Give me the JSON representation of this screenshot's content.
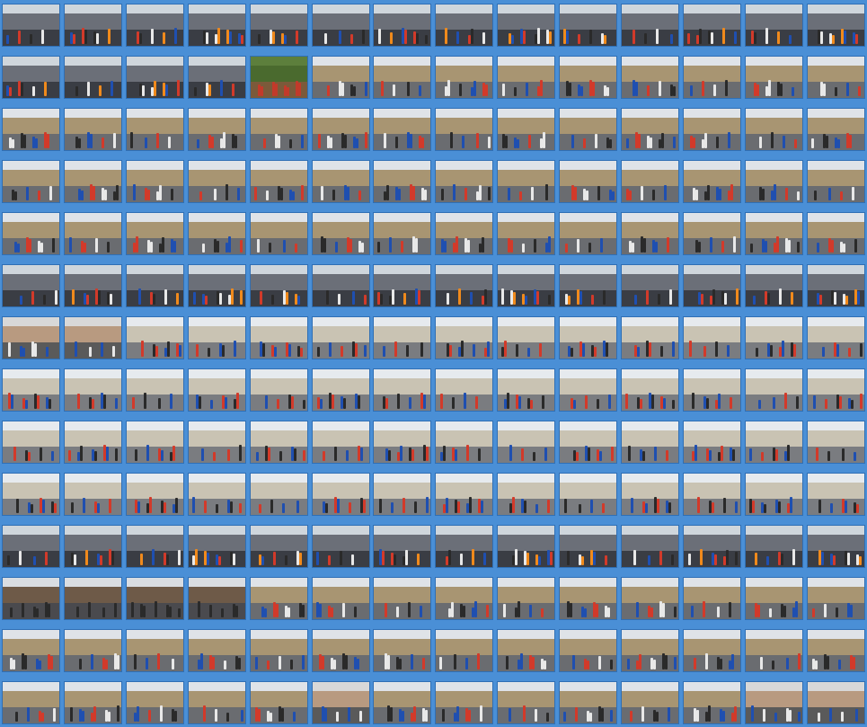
{
  "gallery": {
    "background": "#4a8fd6",
    "rows": [
      {
        "cells": [
          "crowd",
          "crowd",
          "crowd",
          "crowd",
          "crowd",
          "crowd",
          "crowd",
          "crowd",
          "crowd",
          "crowd",
          "crowd",
          "crowd",
          "crowd",
          "crowd",
          "crowd",
          "crowd",
          "crowd",
          "crowd",
          "crowd",
          "crowd",
          "crowd",
          "crowd",
          "crowd",
          "crowd",
          "crowd",
          "crowd",
          "crowd",
          "crowd"
        ]
      },
      {
        "cells": [
          "crowd",
          "crowd",
          "crowd",
          "crowd",
          "garden",
          "street",
          "street",
          "street",
          "street",
          "street",
          "street",
          "street",
          "street",
          "street",
          "street",
          "street",
          "street",
          "street",
          "street",
          "street",
          "street",
          "street",
          "street",
          "street",
          "street",
          "street",
          "street",
          "street"
        ]
      },
      {
        "cells": [
          "street",
          "street",
          "street",
          "street",
          "street",
          "street",
          "street",
          "street",
          "street",
          "street",
          "street",
          "street",
          "street",
          "street",
          "street",
          "street",
          "street",
          "street",
          "street",
          "street",
          "street",
          "street",
          "street",
          "street",
          "street",
          "street",
          "street",
          "street"
        ]
      },
      {
        "cells": [
          "street",
          "street",
          "street",
          "street",
          "street",
          "street",
          "street",
          "street",
          "street",
          "street",
          "street",
          "street",
          "street",
          "street",
          "street",
          "street",
          "street",
          "street",
          "street",
          "street",
          "street",
          "street",
          "street",
          "street",
          "street",
          "street",
          "street",
          "street"
        ]
      },
      {
        "cells": [
          "street",
          "street",
          "street",
          "street",
          "street",
          "street",
          "street",
          "street",
          "street",
          "street",
          "street",
          "street",
          "street",
          "street",
          "street",
          "street",
          "street",
          "street",
          "street",
          "street",
          "street",
          "street",
          "street",
          "street",
          "street",
          "street",
          "street",
          "street"
        ]
      },
      {
        "cells": [
          "crowd",
          "crowd",
          "crowd",
          "crowd",
          "crowd",
          "crowd",
          "crowd",
          "crowd",
          "crowd",
          "crowd",
          "crowd",
          "crowd",
          "crowd",
          "crowd",
          "crowd",
          "crowd",
          "crowd",
          "crowd",
          "crowd",
          "crowd",
          "crowd",
          "crowd",
          "crowd",
          "crowd",
          "crowd",
          "crowd",
          "crowd",
          "crowd"
        ]
      },
      {
        "cells": [
          "close",
          "close",
          "piazza",
          "piazza",
          "piazza",
          "piazza",
          "piazza",
          "piazza",
          "piazza",
          "piazza",
          "piazza",
          "piazza",
          "piazza",
          "piazza",
          "piazza",
          "piazza",
          "piazza",
          "piazza",
          "piazza",
          "piazza",
          "piazza",
          "piazza",
          "piazza",
          "piazza",
          "piazza",
          "piazza",
          "piazza",
          "piazza"
        ]
      },
      {
        "cells": [
          "piazza",
          "piazza",
          "piazza",
          "piazza",
          "piazza",
          "piazza",
          "piazza",
          "piazza",
          "piazza",
          "piazza",
          "piazza",
          "piazza",
          "piazza",
          "piazza",
          "piazza",
          "piazza",
          "piazza",
          "piazza",
          "piazza",
          "piazza",
          "piazza",
          "piazza",
          "piazza",
          "piazza",
          "piazza",
          "piazza",
          "piazza",
          "piazza"
        ]
      },
      {
        "cells": [
          "piazza",
          "piazza",
          "piazza",
          "piazza",
          "piazza",
          "piazza",
          "piazza",
          "piazza",
          "piazza",
          "piazza",
          "piazza",
          "piazza",
          "piazza",
          "piazza",
          "piazza",
          "piazza",
          "piazza",
          "piazza",
          "piazza",
          "piazza",
          "piazza",
          "piazza",
          "piazza",
          "piazza",
          "piazza",
          "piazza",
          "piazza",
          "piazza"
        ]
      },
      {
        "cells": [
          "piazza",
          "piazza",
          "piazza",
          "piazza",
          "piazza",
          "piazza",
          "piazza",
          "piazza",
          "piazza",
          "piazza",
          "piazza",
          "piazza",
          "piazza",
          "piazza",
          "piazza",
          "piazza",
          "piazza",
          "piazza",
          "piazza",
          "piazza",
          "piazza",
          "piazza",
          "piazza",
          "piazza",
          "piazza",
          "piazza",
          "piazza",
          "piazza"
        ]
      },
      {
        "cells": [
          "crowd",
          "crowd",
          "crowd",
          "crowd",
          "crowd",
          "crowd",
          "crowd",
          "crowd",
          "crowd",
          "crowd",
          "crowd",
          "crowd",
          "crowd",
          "crowd",
          "crowd",
          "crowd",
          "crowd",
          "crowd",
          "close",
          "crowd",
          "crowd",
          "crowd",
          "crowd",
          "crowd",
          "crowd",
          "crowd",
          "crowd",
          "crowd"
        ]
      },
      {
        "cells": [
          "old",
          "old",
          "old",
          "old",
          "street",
          "street",
          "street",
          "street",
          "street",
          "street",
          "street",
          "street",
          "street",
          "street",
          "street",
          "street",
          "street",
          "street",
          "street",
          "street",
          "street",
          "street",
          "street",
          "street",
          "street",
          "street",
          "street",
          "street"
        ]
      },
      {
        "cells": [
          "street",
          "street",
          "street",
          "street",
          "street",
          "street",
          "street",
          "street",
          "street",
          "street",
          "street",
          "street",
          "street",
          "street",
          "street",
          "street",
          "street",
          "street",
          "street",
          "street",
          "street",
          "street",
          "street",
          "street",
          "street",
          "street",
          "street",
          "street"
        ]
      },
      {
        "cells": [
          "street",
          "street",
          "street",
          "street",
          "street",
          "close",
          "street",
          "street",
          "street",
          "street",
          "street",
          "street",
          "close",
          "close",
          "crowd",
          "crowd",
          "crowd",
          "crowd",
          "close",
          "close",
          "close",
          "close",
          "crowd",
          "crowd",
          "crowd",
          "crowd",
          "crowd",
          "crowd"
        ]
      }
    ]
  },
  "palette": {
    "crowd": {
      "sky": "#cfd6dc",
      "bld": "#6b6f78",
      "road": "#3a3d44",
      "figs": [
        "#1f4fb0",
        "#d23a2a",
        "#2a2a2a",
        "#e8e8e8",
        "#f08a1c"
      ]
    },
    "street": {
      "sky": "#dfe3e8",
      "bld": "#a89572",
      "road": "#6a6c70",
      "figs": [
        "#1f4fb0",
        "#d23a2a",
        "#e8e8e8",
        "#2a2a2a"
      ]
    },
    "piazza": {
      "sky": "#e6eaee",
      "bld": "#c9c3b3",
      "road": "#7a7c80",
      "figs": [
        "#2a2a2a",
        "#1f4fb0",
        "#d23a2a"
      ]
    },
    "old": {
      "sky": "#d9dde2",
      "bld": "#6e5a48",
      "road": "#4a4a4e",
      "figs": [
        "#2a2a2a"
      ]
    },
    "garden": {
      "sky": "#5d7f3c",
      "bld": "#4a6a2e",
      "road": "#7b5a3a",
      "figs": [
        "#c23a2a"
      ]
    },
    "close": {
      "sky": "#d8d8d8",
      "bld": "#b89a80",
      "road": "#5a5a5a",
      "figs": [
        "#1f4fb0",
        "#e8e8e8"
      ]
    }
  }
}
